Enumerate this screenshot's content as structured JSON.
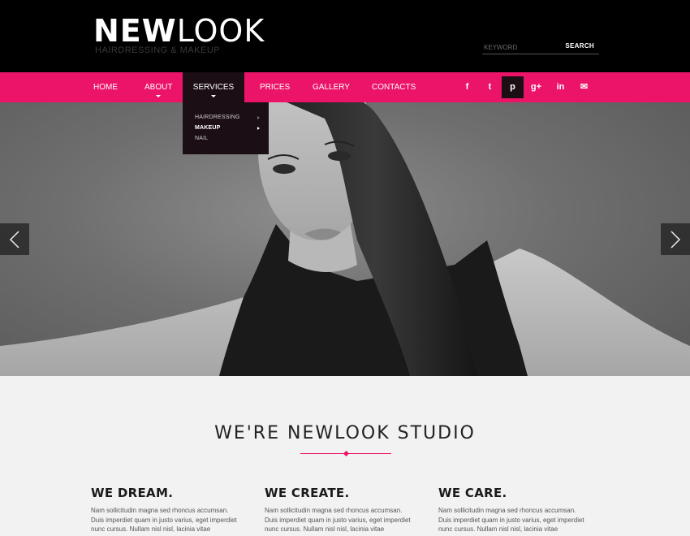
{
  "header": {
    "logo_bold": "NEW",
    "logo_light": "LOOK",
    "tagline": "HAIRDRESSING & MAKEUP",
    "search_placeholder": "KEYWORD",
    "search_button": "SEARCH"
  },
  "nav": {
    "items": [
      {
        "label": "HOME"
      },
      {
        "label": "ABOUT"
      },
      {
        "label": "SERVICES"
      },
      {
        "label": "PRICES"
      },
      {
        "label": "GALLERY"
      },
      {
        "label": "CONTACTS"
      }
    ],
    "active": "SERVICES",
    "social": [
      {
        "icon": "facebook-icon",
        "glyph": "f"
      },
      {
        "icon": "twitter-icon",
        "glyph": "t"
      },
      {
        "icon": "pinterest-icon",
        "glyph": "p"
      },
      {
        "icon": "google-plus-icon",
        "glyph": "g+"
      },
      {
        "icon": "linkedin-icon",
        "glyph": "in"
      },
      {
        "icon": "mail-icon",
        "glyph": "✉"
      }
    ]
  },
  "dropdown": {
    "items": [
      {
        "label": "HAIRDRESSING"
      },
      {
        "label": "MAKEUP"
      },
      {
        "label": "NAIL"
      }
    ],
    "active": "MAKEUP"
  },
  "main": {
    "title": "WE'RE NEWLOOK STUDIO",
    "columns": [
      {
        "heading": "WE DREAM.",
        "text": "Nam sollicitudin magna sed rhoncus accumsan. Duis imperdiet quam in justo varius, eget imperdiet nunc cursus. Nullam nisl nisl, lacinia vitae"
      },
      {
        "heading": "WE CREATE.",
        "text": "Nam sollicitudin magna sed rhoncus accumsan. Duis imperdiet quam in justo varius, eget imperdiet nunc cursus. Nullam nisl nisl, lacinia vitae"
      },
      {
        "heading": "WE CARE.",
        "text": "Nam sollicitudin magna sed rhoncus accumsan. Duis imperdiet quam in justo varius, eget imperdiet nunc cursus. Nullam nisl nisl, lacinia vitae"
      }
    ]
  },
  "colors": {
    "accent": "#eb1468",
    "header_bg": "#000000",
    "active_nav_bg": "#1b0e14",
    "page_bg": "#f2f2f2"
  }
}
